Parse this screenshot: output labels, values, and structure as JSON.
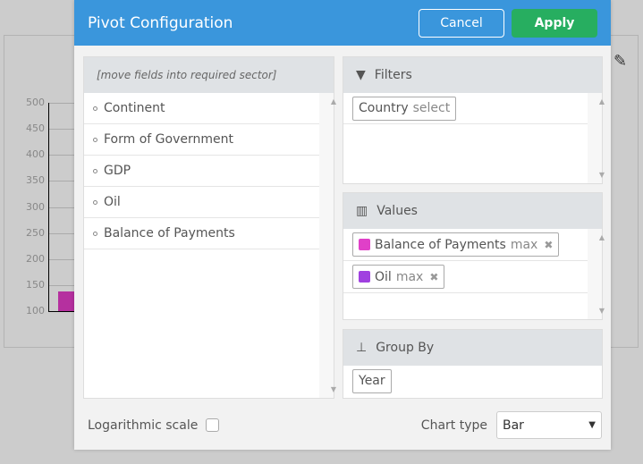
{
  "background_chart": {
    "y_ticks": [
      "500",
      "450",
      "400",
      "350",
      "300",
      "250",
      "200",
      "150",
      "100"
    ],
    "bar_value": 137,
    "bar_color": "#b5309f",
    "ylim": [
      100,
      500
    ]
  },
  "modal": {
    "title": "Pivot Configuration",
    "cancel_label": "Cancel",
    "apply_label": "Apply",
    "header_color": "#3a96dc",
    "apply_color": "#27ae60"
  },
  "fields": {
    "header": "[move fields into required sector]",
    "items": [
      "Continent",
      "Form of Government",
      "GDP",
      "Oil",
      "Balance of Payments"
    ]
  },
  "filters": {
    "title": "Filters",
    "icon": "filter-icon",
    "chips": [
      {
        "label": "Country",
        "agg": "select"
      }
    ]
  },
  "values": {
    "title": "Values",
    "icon": "bar-chart-icon",
    "chips": [
      {
        "label": "Balance of Payments",
        "agg": "max",
        "color": "#e040c8"
      },
      {
        "label": "Oil",
        "agg": "max",
        "color": "#a040e0"
      }
    ]
  },
  "group_by": {
    "title": "Group By",
    "icon": "sitemap-icon",
    "chips": [
      {
        "label": "Year"
      }
    ]
  },
  "footer": {
    "log_label": "Logarithmic scale",
    "log_checked": false,
    "chart_type_label": "Chart type",
    "chart_type_value": "Bar"
  }
}
